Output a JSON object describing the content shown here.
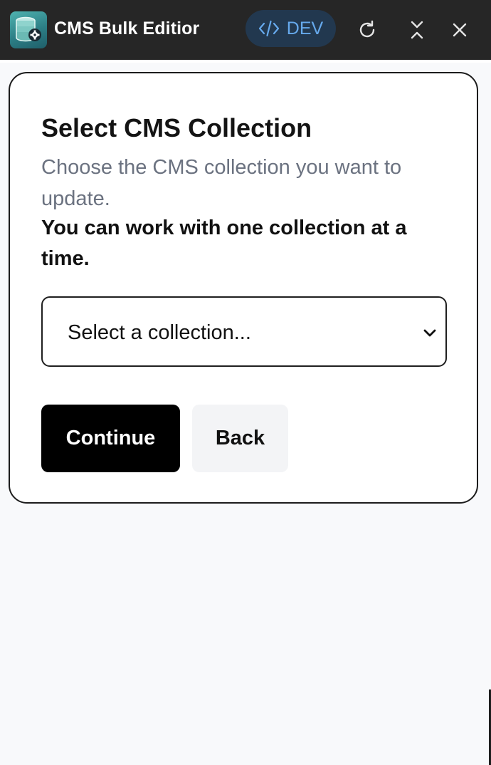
{
  "titlebar": {
    "app_title": "CMS Bulk Editior",
    "app_icon": "database-gear-icon",
    "env_badge": "DEV",
    "env_icon": "code-icon",
    "buttons": {
      "refresh": "refresh-icon",
      "collapse": "collapse-icon",
      "close": "close-icon"
    },
    "colors": {
      "bar": "#262626",
      "badge_bg": "#22384f",
      "badge_text": "#66a9ec"
    }
  },
  "card": {
    "title": "Select CMS Collection",
    "description": "Choose the CMS collection you want to update.",
    "note": "You can work with one collection at a time.",
    "select": {
      "value": "Select a collection...",
      "icon": "chevron-down-icon"
    },
    "buttons": {
      "continue": "Continue",
      "back": "Back"
    }
  }
}
